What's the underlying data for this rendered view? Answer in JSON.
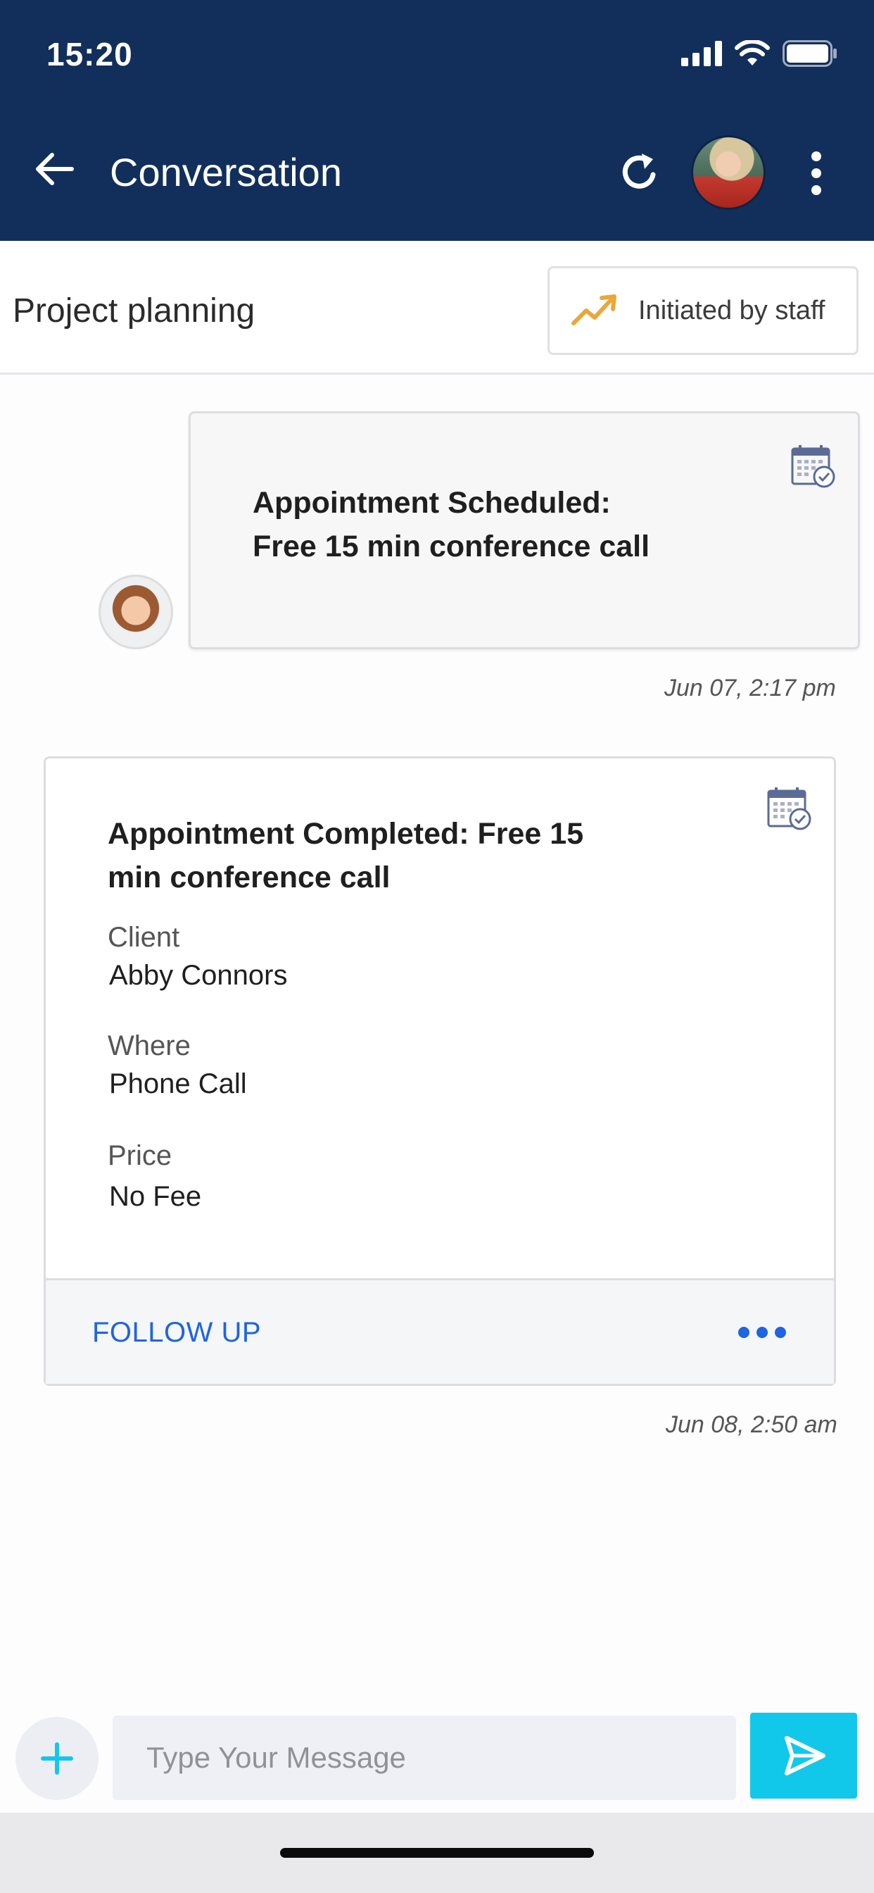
{
  "status_bar": {
    "time": "15:20"
  },
  "header": {
    "title": "Conversation"
  },
  "topic": {
    "title": "Project planning",
    "initiator_label": "Initiated by staff",
    "initiator_icon": "trending-up-icon",
    "initiator_icon_color": "#e9a83a"
  },
  "messages": [
    {
      "type": "appointment-scheduled",
      "line1": "Appointment Scheduled:",
      "line2": "Free 15 min conference call",
      "timestamp": "Jun 07, 2:17 pm"
    },
    {
      "type": "appointment-completed",
      "title": "Appointment Completed:  Free 15 min conference call",
      "fields": [
        {
          "label": "Client",
          "value": "Abby Connors"
        },
        {
          "label": "Where",
          "value": "Phone Call"
        },
        {
          "label": "Price",
          "value": "No Fee"
        }
      ],
      "action_label": "FOLLOW UP",
      "timestamp": "Jun 08, 2:50 am"
    }
  ],
  "composer": {
    "placeholder": "Type Your Message"
  },
  "colors": {
    "header_bg": "#122f5c",
    "accent_link": "#1f64e0",
    "send_button": "#12c8ea",
    "add_plus": "#12c8ea"
  }
}
